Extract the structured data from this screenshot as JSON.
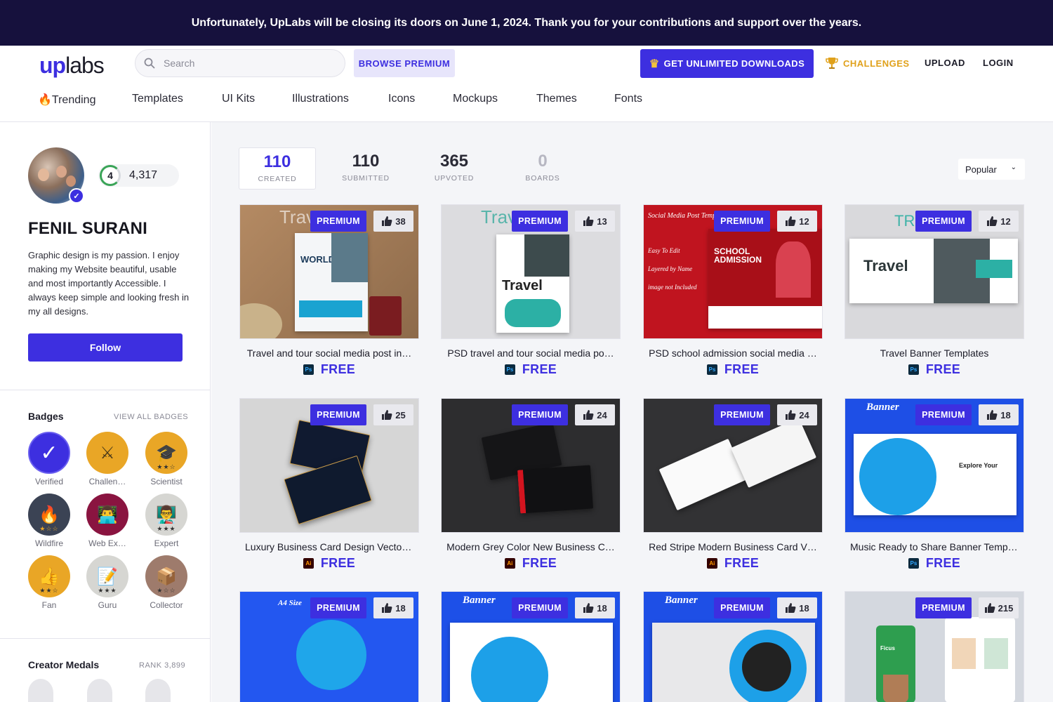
{
  "banner": {
    "text": "Unfortunately, UpLabs will be closing its doors on June 1, 2024. Thank you for your contributions and support over the years."
  },
  "header": {
    "logo_up": "up",
    "logo_labs": "labs",
    "search_placeholder": "Search",
    "browse_premium": "BROWSE PREMIUM",
    "unlimited_downloads": "GET UNLIMITED DOWNLOADS",
    "challenges": "CHALLENGES",
    "upload": "UPLOAD",
    "login": "LOGIN"
  },
  "nav": {
    "items": [
      "Trending",
      "Templates",
      "UI Kits",
      "Illustrations",
      "Icons",
      "Mockups",
      "Themes",
      "Fonts"
    ]
  },
  "profile": {
    "level": "4",
    "points": "4,317",
    "name": "FENIL SURANI",
    "bio": "Graphic design is my passion. I enjoy making my Website beautiful, usable and most importantly Accessible. I always keep simple and looking fresh in my all designs.",
    "follow_label": "Follow"
  },
  "badges": {
    "title": "Badges",
    "view_all": "VIEW ALL BADGES",
    "items": [
      {
        "label": "Verified",
        "icon": "check-icon"
      },
      {
        "label": "Challen…",
        "icon": "crossed-swords-icon"
      },
      {
        "label": "Scientist",
        "icon": "graduation-cap-icon"
      },
      {
        "label": "Wildfire",
        "icon": "fire-icon"
      },
      {
        "label": "Web Ex…",
        "icon": "laptop-user-icon"
      },
      {
        "label": "Expert",
        "icon": "professor-icon"
      },
      {
        "label": "Fan",
        "icon": "thumbs-up-icon"
      },
      {
        "label": "Guru",
        "icon": "notepad-icon"
      },
      {
        "label": "Collector",
        "icon": "box-icon"
      }
    ]
  },
  "medals": {
    "title": "Creator Medals",
    "rank": "RANK 3,899"
  },
  "stats": [
    {
      "value": "110",
      "label": "CREATED"
    },
    {
      "value": "110",
      "label": "SUBMITTED"
    },
    {
      "value": "365",
      "label": "UPVOTED"
    },
    {
      "value": "0",
      "label": "BOARDS"
    }
  ],
  "sort": {
    "selected": "Popular"
  },
  "premium_label": "PREMIUM",
  "cards": [
    {
      "title": "Travel and tour social media post in…",
      "likes": "38",
      "app": "Ps",
      "price": "FREE",
      "thumb_text": "Travel"
    },
    {
      "title": "PSD travel and tour social media po…",
      "likes": "13",
      "app": "Ps",
      "price": "FREE",
      "thumb_text": "Travel"
    },
    {
      "title": "PSD school admission social media …",
      "likes": "12",
      "app": "Ps",
      "price": "FREE",
      "thumb_text": "SCHOOL ADMISSION"
    },
    {
      "title": "Travel Banner Templates",
      "likes": "12",
      "app": "Ps",
      "price": "FREE",
      "thumb_text": "Travel"
    },
    {
      "title": "Luxury Business Card Design Vector…",
      "likes": "25",
      "app": "Ai",
      "price": "FREE",
      "thumb_text": ""
    },
    {
      "title": "Modern Grey Color New Business C…",
      "likes": "24",
      "app": "Ai",
      "price": "FREE",
      "thumb_text": ""
    },
    {
      "title": "Red Stripe Modern Business Card V…",
      "likes": "24",
      "app": "Ai",
      "price": "FREE",
      "thumb_text": ""
    },
    {
      "title": "Music Ready to Share Banner Templ…",
      "likes": "18",
      "app": "Ps",
      "price": "FREE",
      "thumb_text": "Banner"
    },
    {
      "title": "",
      "likes": "18",
      "app": "",
      "price": "",
      "thumb_text": "A4 Size"
    },
    {
      "title": "",
      "likes": "18",
      "app": "",
      "price": "",
      "thumb_text": "Banner"
    },
    {
      "title": "",
      "likes": "18",
      "app": "",
      "price": "",
      "thumb_text": "Banner"
    },
    {
      "title": "",
      "likes": "215",
      "app": "",
      "price": "",
      "thumb_text": "Ficus"
    }
  ]
}
